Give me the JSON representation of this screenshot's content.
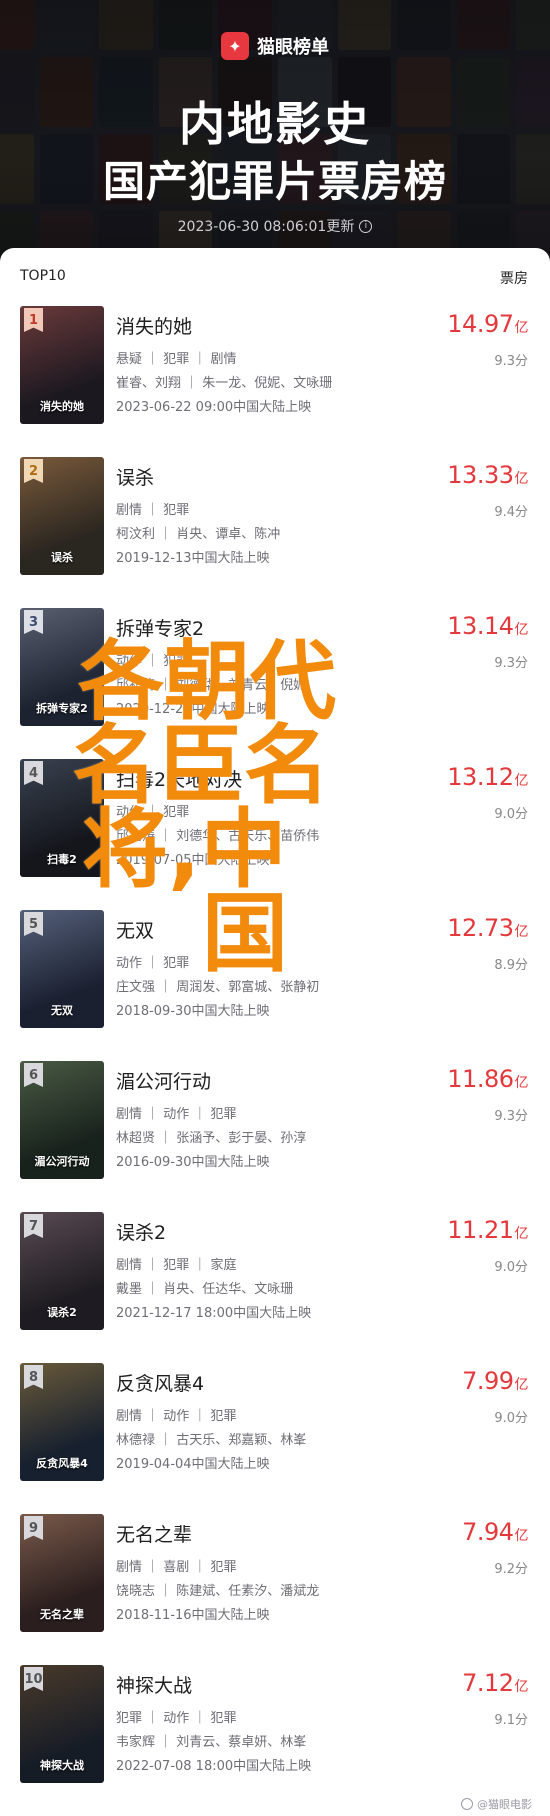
{
  "header": {
    "brand": "猫眼榜单",
    "title_line1": "内地影史",
    "title_line2": "国产犯罪片票房榜",
    "timestamp": "2023-06-30 08:06:01更新"
  },
  "list_header": {
    "left": "TOP10",
    "right": "票房"
  },
  "movies": [
    {
      "rank": "1",
      "title": "消失的她",
      "genres": "悬疑 ｜ 犯罪 ｜ 剧情",
      "cast": "崔睿、刘翔 ｜ 朱一龙、倪妮、文咏珊",
      "release": "2023-06-22 09:00中国大陆上映",
      "box": "14.97",
      "unit": "亿",
      "score": "9.3分",
      "poster_text": "消失的她"
    },
    {
      "rank": "2",
      "title": "误杀",
      "genres": "剧情 ｜ 犯罪",
      "cast": "柯汶利 ｜ 肖央、谭卓、陈冲",
      "release": "2019-12-13中国大陆上映",
      "box": "13.33",
      "unit": "亿",
      "score": "9.4分",
      "poster_text": "误杀"
    },
    {
      "rank": "3",
      "title": "拆弹专家2",
      "genres": "动作 ｜ 犯罪",
      "cast": "邱礼涛 ｜ 刘德华、刘青云、倪妮",
      "release": "2020-12-24中国大陆上映",
      "box": "13.14",
      "unit": "亿",
      "score": "9.3分",
      "poster_text": "拆弹专家2"
    },
    {
      "rank": "4",
      "title": "扫毒2天地对决",
      "genres": "动作 ｜ 犯罪",
      "cast": "邱礼涛 ｜ 刘德华、古天乐、苗侨伟",
      "release": "2019-07-05中国大陆上映",
      "box": "13.12",
      "unit": "亿",
      "score": "9.0分",
      "poster_text": "扫毒2"
    },
    {
      "rank": "5",
      "title": "无双",
      "genres": "动作 ｜ 犯罪",
      "cast": "庄文强 ｜ 周润发、郭富城、张静初",
      "release": "2018-09-30中国大陆上映",
      "box": "12.73",
      "unit": "亿",
      "score": "8.9分",
      "poster_text": "无双"
    },
    {
      "rank": "6",
      "title": "湄公河行动",
      "genres": "剧情 ｜ 动作 ｜ 犯罪",
      "cast": "林超贤 ｜ 张涵予、彭于晏、孙淳",
      "release": "2016-09-30中国大陆上映",
      "box": "11.86",
      "unit": "亿",
      "score": "9.3分",
      "poster_text": "湄公河行动"
    },
    {
      "rank": "7",
      "title": "误杀2",
      "genres": "剧情 ｜ 犯罪 ｜ 家庭",
      "cast": "戴墨 ｜ 肖央、任达华、文咏珊",
      "release": "2021-12-17 18:00中国大陆上映",
      "box": "11.21",
      "unit": "亿",
      "score": "9.0分",
      "poster_text": "误杀2"
    },
    {
      "rank": "8",
      "title": "反贪风暴4",
      "genres": "剧情 ｜ 动作 ｜ 犯罪",
      "cast": "林德禄 ｜ 古天乐、郑嘉颖、林峯",
      "release": "2019-04-04中国大陆上映",
      "box": "7.99",
      "unit": "亿",
      "score": "9.0分",
      "poster_text": "反贪风暴4"
    },
    {
      "rank": "9",
      "title": "无名之辈",
      "genres": "剧情 ｜ 喜剧 ｜ 犯罪",
      "cast": "饶晓志 ｜ 陈建斌、任素汐、潘斌龙",
      "release": "2018-11-16中国大陆上映",
      "box": "7.94",
      "unit": "亿",
      "score": "9.2分",
      "poster_text": "无名之辈"
    },
    {
      "rank": "10",
      "title": "神探大战",
      "genres": "犯罪 ｜ 动作 ｜ 犯罪",
      "cast": "韦家辉 ｜ 刘青云、蔡卓妍、林峯",
      "release": "2022-07-08 18:00中国大陆上映",
      "box": "7.12",
      "unit": "亿",
      "score": "9.1分",
      "poster_text": "神探大战"
    }
  ],
  "watermark": {
    "line1": "各朝代",
    "line2": "名臣名",
    "line3": "将,中",
    "line4": "国"
  },
  "credit": "@猫眼电影",
  "colors": {
    "accent_red": "#e4393c",
    "watermark_orange": "#f28a0c"
  }
}
